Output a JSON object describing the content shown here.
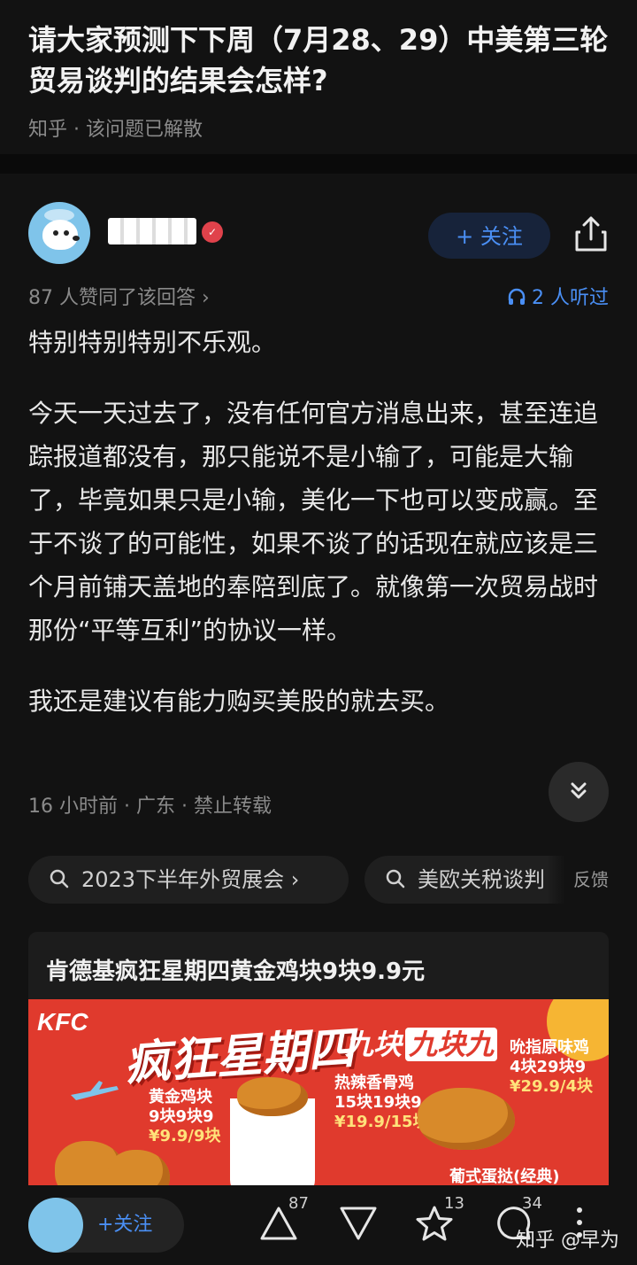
{
  "question": {
    "title": "请大家预测下下周（7月28、29）中美第三轮贸易谈判的结果会怎样?",
    "subtitle": "知乎 · 该问题已解散"
  },
  "author": {
    "follow_label": "+ 关注"
  },
  "meta": {
    "upvotes_text": "87 人赞同了该回答 ›",
    "listen_text": "2 人听过"
  },
  "content": {
    "paragraphs": [
      "特别特别特别不乐观。",
      "今天一天过去了，没有任何官方消息出来，甚至连追踪报道都没有，那只能说不是小输了，可能是大输了，毕竟如果只是小输，美化一下也可以变成赢。至于不谈了的可能性，如果不谈了的话现在就应该是三个月前铺天盖地的奉陪到底了。就像第一次贸易战时那份“平等互利”的协议一样。",
      "我还是建议有能力购买美股的就去买。"
    ]
  },
  "footer": {
    "meta_text": "16 小时前 · 广东 · 禁止转载"
  },
  "tags": {
    "items": [
      "2023下半年外贸展会 ›",
      "美欧关税谈判"
    ],
    "feedback": "反馈"
  },
  "ad": {
    "title": "肯德基疯狂星期四黄金鸡块9块9.9元",
    "banner": {
      "brand": "KFC",
      "headline": "疯狂星期四",
      "promo_prefix": "九块",
      "promo_box": "九块九",
      "item1_name": "黄金鸡块",
      "item1_price": "9块9块9",
      "item1_unit": "¥9.9/9块",
      "item2_name": "热辣香骨鸡",
      "item2_price": "15块19块9",
      "item2_unit": "¥19.9/15块",
      "item3_name": "吮指原味鸡",
      "item3_price": "4块29块9",
      "item3_unit": "¥29.9/4块",
      "item4_name": "葡式蛋挞(经典)"
    }
  },
  "bottom_bar": {
    "follow_label": "+关注",
    "upvote_count": "87",
    "star_count": "13",
    "comment_count": "34",
    "watermark": "知乎 @早为"
  },
  "colors": {
    "accent": "#4a8ff5",
    "background": "#121212",
    "ad_red": "#e03a2d"
  }
}
